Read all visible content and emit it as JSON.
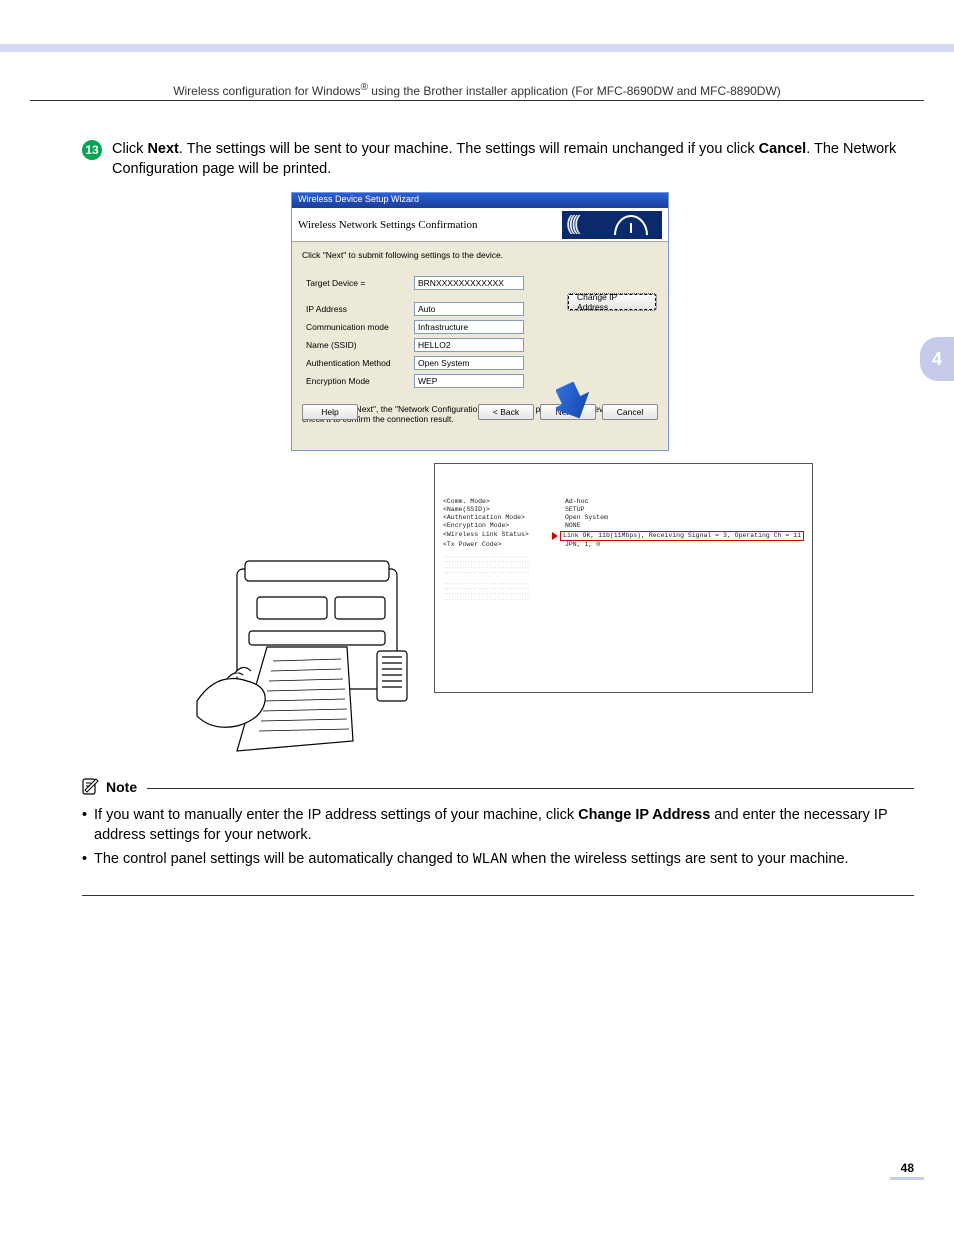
{
  "header": {
    "line1_pre": "Wireless configuration for Windows",
    "line1_sup": "®",
    "line1_post": " using the Brother installer application (For MFC-8690DW and MFC-8890DW)"
  },
  "step": {
    "number": "13",
    "text_pre": "Click ",
    "bold1": "Next",
    "text_mid": ". The settings will be sent to your machine. The settings will remain unchanged if you click ",
    "bold2": "Cancel",
    "text_post": ". The Network Configuration page will be printed."
  },
  "wizard": {
    "titlebar": "Wireless Device Setup Wizard",
    "header_title": "Wireless Network Settings Confirmation",
    "intro": "Click \"Next\" to submit following settings to the device.",
    "fields": {
      "target_label": "Target Device =",
      "target_value": "BRNXXXXXXXXXXXX",
      "ip_label": "IP Address",
      "ip_value": "Auto",
      "comm_label": "Communication mode",
      "comm_value": "Infrastructure",
      "ssid_label": "Name (SSID)",
      "ssid_value": "HELLO2",
      "auth_label": "Authentication Method",
      "auth_value": "Open System",
      "enc_label": "Encryption Mode",
      "enc_value": "WEP"
    },
    "change_ip_btn": "Change IP Address",
    "after_text": "After clicking \"Next\", the \"Network Configuration\" Page will be printed by the device. Please check it to confirm the connection result.",
    "help_btn": "Help",
    "back_btn": "< Back",
    "next_btn": "Next >",
    "cancel_btn": "Cancel"
  },
  "printout": {
    "rows": {
      "comm_k": "<Comm. Mode>",
      "comm_v": "Ad-hoc",
      "ssid_k": "<Name(SSID)>",
      "ssid_v": "SETUP",
      "auth_k": "<Authentication Mode>",
      "auth_v": "Open System",
      "enc_k": "<Encryption Mode>",
      "enc_v": "NONE",
      "link_k": "<Wireless Link Status>",
      "link_v": "Link OK, 11b(11Mbps), Receiving Signal = 3, Operating Ch = 11",
      "tx_k": "<Tx Power Code>",
      "tx_v": "JPN, 1, 0"
    }
  },
  "note": {
    "title": "Note",
    "b1_pre": "If you want to manually enter the IP address settings of your machine, click ",
    "b1_bold": "Change IP Address",
    "b1_post": " and enter the necessary IP address settings for your network.",
    "b2_pre": "The control panel settings will be automatically changed to ",
    "b2_code": "WLAN",
    "b2_post": " when the wireless settings are sent to your machine."
  },
  "side_tab": "4",
  "page_number": "48"
}
